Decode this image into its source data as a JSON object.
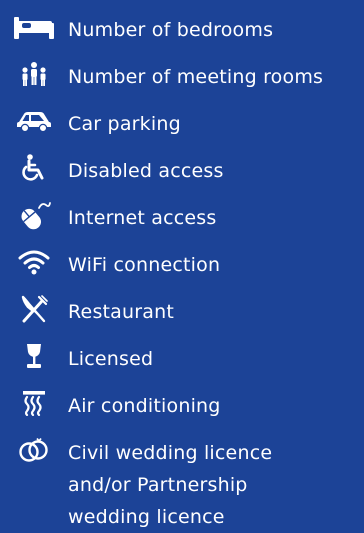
{
  "legend": {
    "items": [
      {
        "icon": "bed-icon",
        "label": "Number of bedrooms"
      },
      {
        "icon": "people-group-icon",
        "label": "Number of meeting rooms"
      },
      {
        "icon": "car-icon",
        "label": "Car parking"
      },
      {
        "icon": "wheelchair-icon",
        "label": "Disabled access"
      },
      {
        "icon": "mouse-icon",
        "label": "Internet access"
      },
      {
        "icon": "wifi-icon",
        "label": "WiFi connection"
      },
      {
        "icon": "knife-fork-icon",
        "label": "Restaurant"
      },
      {
        "icon": "wine-glass-icon",
        "label": "Licensed"
      },
      {
        "icon": "air-conditioning-icon",
        "label": "Air conditioning"
      },
      {
        "icon": "wedding-rings-icon",
        "label_lines": [
          "Civil wedding licence",
          "and/or Partnership",
          "wedding licence"
        ]
      }
    ]
  },
  "colors": {
    "background": "#1c4397",
    "foreground": "#ffffff"
  }
}
